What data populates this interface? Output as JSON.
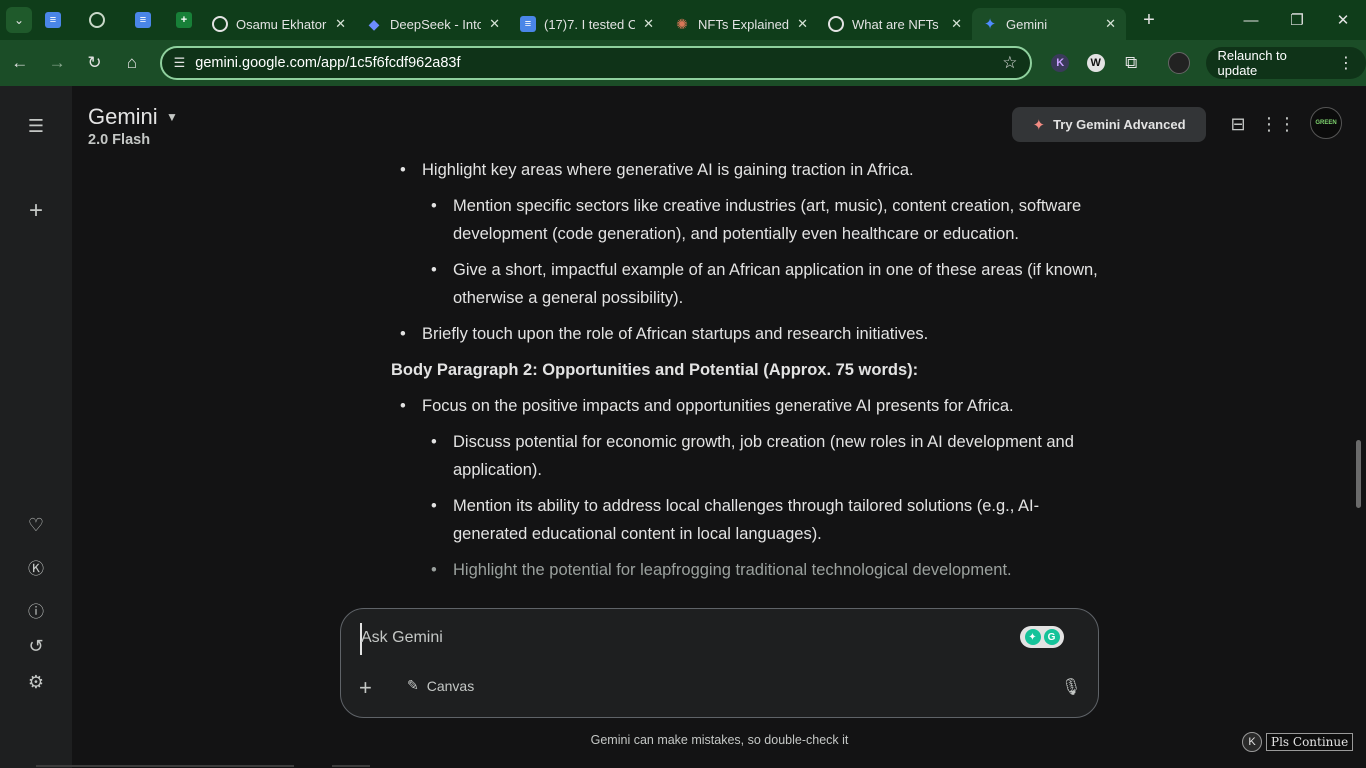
{
  "browser": {
    "tabs": [
      {
        "title": "Osamu Ekhator",
        "icon": "openai-icon"
      },
      {
        "title": "DeepSeek - Into",
        "icon": "deepseek-icon"
      },
      {
        "title": "(17)7. I tested C",
        "icon": "docs-icon"
      },
      {
        "title": "NFTs Explained",
        "icon": "claude-icon"
      },
      {
        "title": "What are NFTs",
        "icon": "openai-icon"
      },
      {
        "title": "Gemini",
        "icon": "gemini-icon",
        "active": true
      }
    ],
    "url": "gemini.google.com/app/1c5f6fcdf962a83f",
    "relaunch_label": "Relaunch to update"
  },
  "app": {
    "brand": "Gemini",
    "model": "2.0 Flash",
    "try_advanced_label": "Try Gemini Advanced"
  },
  "response": {
    "top_items": [
      {
        "level": 1,
        "text": "Highlight key areas where generative AI is gaining traction in Africa."
      },
      {
        "level": 2,
        "text": "Mention specific sectors like creative industries (art, music), content creation, software development (code generation), and potentially even healthcare or education."
      },
      {
        "level": 2,
        "text": "Give a short, impactful example of an African application in one of these areas (if known, otherwise a general possibility)."
      },
      {
        "level": 1,
        "text": "Briefly touch upon the role of African startups and research initiatives."
      }
    ],
    "heading": "Body Paragraph 2: Opportunities and Potential (Approx. 75 words):",
    "bottom_items": [
      {
        "level": 1,
        "text": "Focus on the positive impacts and opportunities generative AI presents for Africa."
      },
      {
        "level": 2,
        "text": "Discuss potential for economic growth, job creation (new roles in AI development and application)."
      },
      {
        "level": 2,
        "text": "Mention its ability to address local challenges through tailored solutions (e.g., AI-generated educational content in local languages)."
      },
      {
        "level": 2,
        "text": "Highlight the potential for leapfrogging traditional technological development.",
        "faded": true
      }
    ]
  },
  "composer": {
    "placeholder": "Ask Gemini",
    "canvas_label": "Canvas"
  },
  "footer": {
    "disclaimer": "Gemini can make mistakes, so double-check it",
    "pls_continue": "Pls Continue"
  }
}
